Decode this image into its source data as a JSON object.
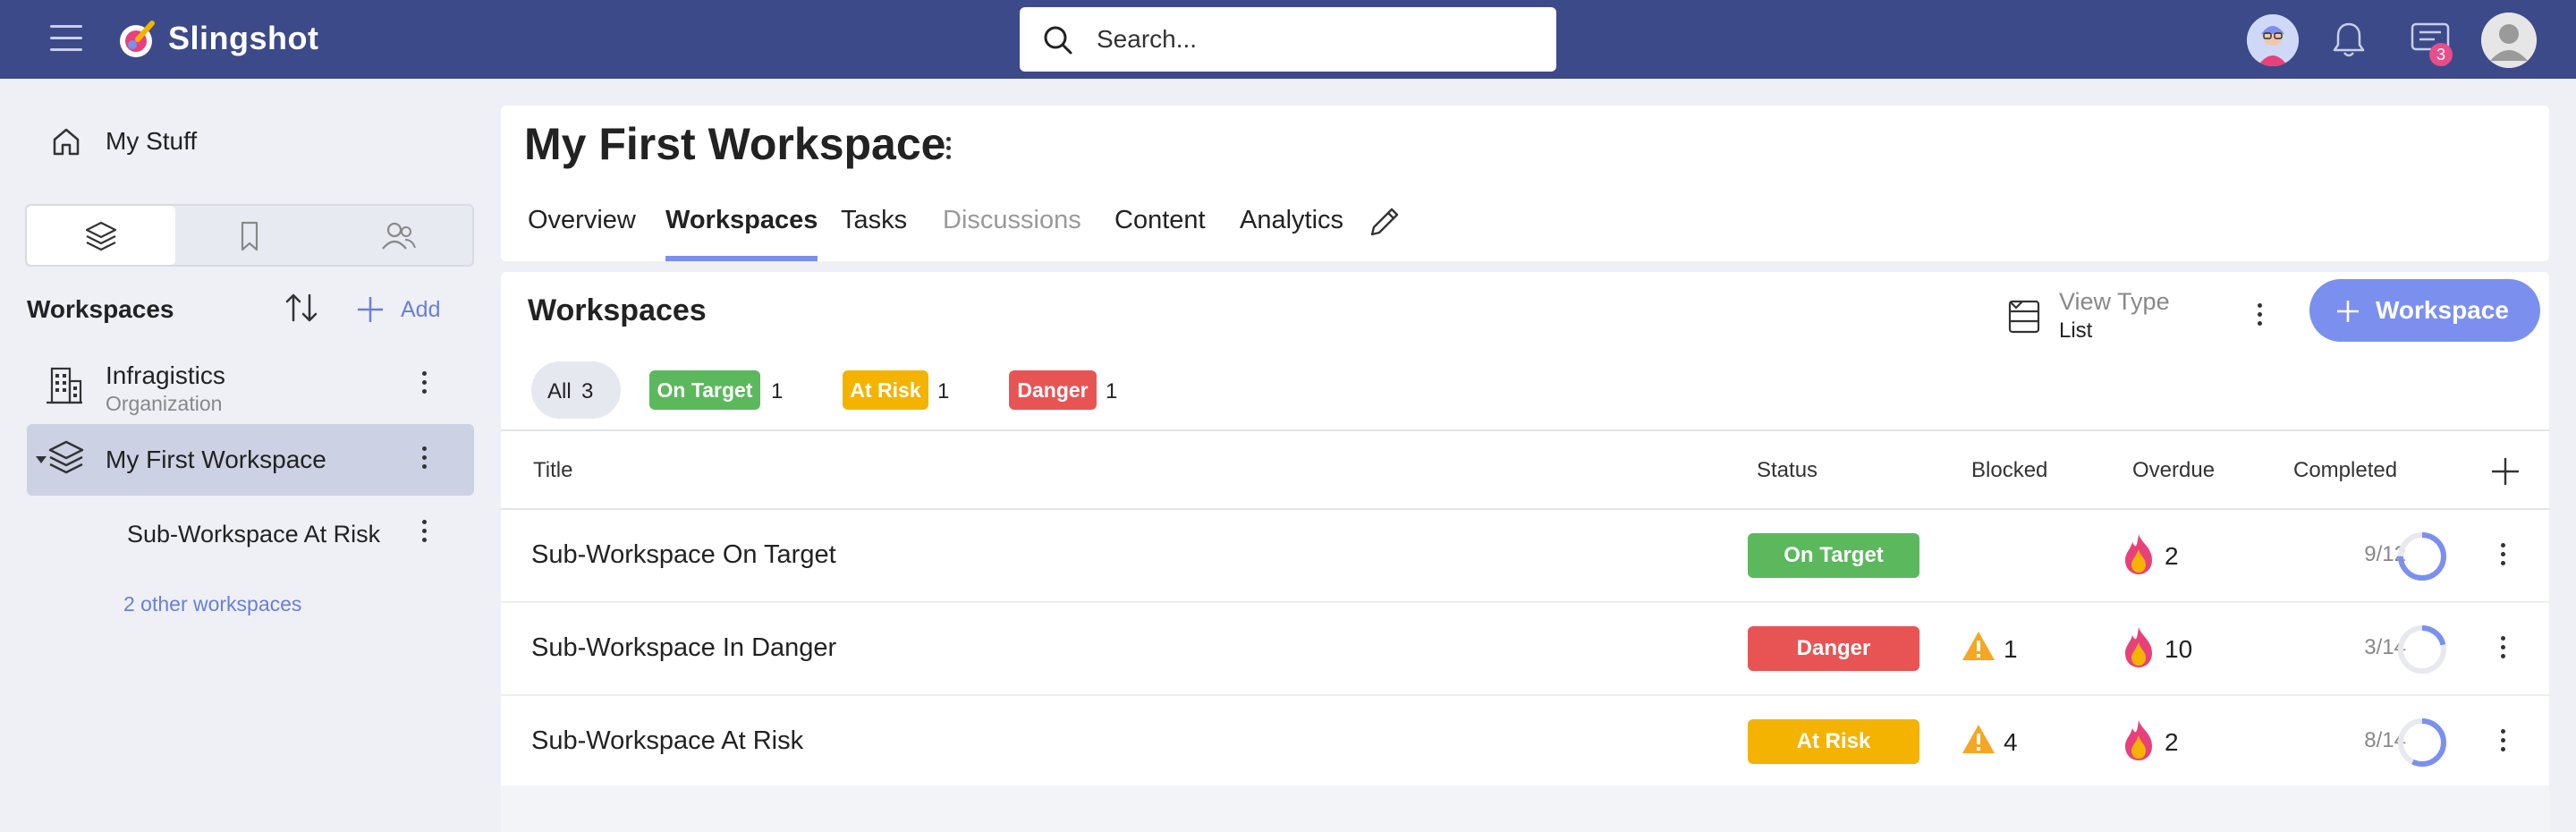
{
  "app": {
    "brand": "Slingshot"
  },
  "search": {
    "placeholder": "Search..."
  },
  "topbar": {
    "messages_badge": "3"
  },
  "sidebar": {
    "my_stuff": "My Stuff",
    "workspaces_heading": "Workspaces",
    "add_label": "Add",
    "tree": {
      "org_name": "Infragistics",
      "org_sub": "Organization",
      "first_ws": "My First Workspace",
      "sub_ws": "Sub-Workspace At Risk"
    },
    "other_workspaces": "2 other workspaces"
  },
  "header": {
    "title": "My First Workspace",
    "tabs": [
      {
        "label": "Overview"
      },
      {
        "label": "Workspaces"
      },
      {
        "label": "Tasks"
      },
      {
        "label": "Discussions"
      },
      {
        "label": "Content"
      },
      {
        "label": "Analytics"
      }
    ]
  },
  "content": {
    "title": "Workspaces",
    "view_type_label": "View Type",
    "view_type_value": "List",
    "add_button": "Workspace",
    "filters": {
      "all_label": "All",
      "all_count": "3",
      "on_target_label": "On Target",
      "on_target_count": "1",
      "at_risk_label": "At Risk",
      "at_risk_count": "1",
      "danger_label": "Danger",
      "danger_count": "1"
    },
    "columns": {
      "title": "Title",
      "status": "Status",
      "blocked": "Blocked",
      "overdue": "Overdue",
      "completed": "Completed"
    },
    "rows": [
      {
        "title": "Sub-Workspace On Target",
        "status": "On Target",
        "blocked": "",
        "overdue": "2",
        "completed": "9/12",
        "done": 9,
        "total": 12
      },
      {
        "title": "Sub-Workspace In Danger",
        "status": "Danger",
        "blocked": "1",
        "overdue": "10",
        "completed": "3/14",
        "done": 3,
        "total": 14
      },
      {
        "title": "Sub-Workspace At Risk",
        "status": "At Risk",
        "blocked": "4",
        "overdue": "2",
        "completed": "8/14",
        "done": 8,
        "total": 14
      }
    ]
  },
  "colors": {
    "topbar": "#3c4a8a",
    "accent": "#7b90ee",
    "on_target": "#5cb85c",
    "at_risk": "#f5b301",
    "danger": "#e85454"
  }
}
